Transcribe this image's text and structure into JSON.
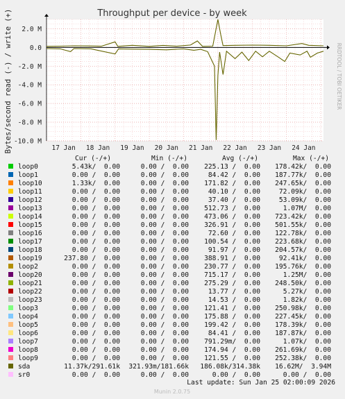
{
  "chart_data": {
    "type": "line",
    "title": "Throughput per device - by week",
    "ylabel": "Bytes/second read (-) / write (+)",
    "side_label": "RRDTOOL / TOBI OETIKER",
    "ylim": [
      -10000000,
      3000000
    ],
    "y_ticks": [
      {
        "value": 2000000,
        "label": "2.0 M"
      },
      {
        "value": 0,
        "label": "0.0"
      },
      {
        "value": -2000000,
        "label": "-2.0 M"
      },
      {
        "value": -4000000,
        "label": "-4.0 M"
      },
      {
        "value": -6000000,
        "label": "-6.0 M"
      },
      {
        "value": -8000000,
        "label": "-8.0 M"
      },
      {
        "value": -10000000,
        "label": "-10.0 M"
      }
    ],
    "x_ticks": [
      {
        "day": 0.5,
        "label": "17 Jan"
      },
      {
        "day": 1.5,
        "label": "18 Jan"
      },
      {
        "day": 2.5,
        "label": "19 Jan"
      },
      {
        "day": 3.5,
        "label": "20 Jan"
      },
      {
        "day": 4.5,
        "label": "21 Jan"
      },
      {
        "day": 5.5,
        "label": "22 Jan"
      },
      {
        "day": 6.5,
        "label": "23 Jan"
      },
      {
        "day": 7.5,
        "label": "24 Jan"
      }
    ],
    "x_range_days": [
      0,
      8.08
    ],
    "series": [
      {
        "name": "sda (write)",
        "color": "#666600",
        "points": [
          [
            0,
            120000
          ],
          [
            0.4,
            140000
          ],
          [
            0.8,
            180000
          ],
          [
            1.2,
            160000
          ],
          [
            1.6,
            130000
          ],
          [
            2.0,
            600000
          ],
          [
            2.08,
            120000
          ],
          [
            2.5,
            230000
          ],
          [
            3.0,
            120000
          ],
          [
            3.4,
            220000
          ],
          [
            3.8,
            130000
          ],
          [
            4.2,
            260000
          ],
          [
            4.4,
            700000
          ],
          [
            4.55,
            120000
          ],
          [
            4.85,
            140000
          ],
          [
            5.0,
            3000000
          ],
          [
            5.08,
            1400000
          ],
          [
            5.15,
            200000
          ],
          [
            5.5,
            230000
          ],
          [
            6.0,
            250000
          ],
          [
            6.5,
            230000
          ],
          [
            7.0,
            180000
          ],
          [
            7.45,
            420000
          ],
          [
            7.65,
            230000
          ],
          [
            8.08,
            180000
          ]
        ]
      },
      {
        "name": "sda (read)",
        "color": "#666600",
        "points": [
          [
            0,
            -120000
          ],
          [
            0.4,
            -150000
          ],
          [
            0.7,
            -450000
          ],
          [
            0.8,
            -120000
          ],
          [
            1.3,
            -150000
          ],
          [
            2.0,
            -700000
          ],
          [
            2.1,
            -150000
          ],
          [
            2.5,
            -180000
          ],
          [
            3.0,
            -200000
          ],
          [
            3.5,
            -250000
          ],
          [
            4.0,
            -150000
          ],
          [
            4.3,
            -300000
          ],
          [
            4.5,
            -200000
          ],
          [
            4.7,
            -450000
          ],
          [
            4.9,
            -2000000
          ],
          [
            4.95,
            -9900000
          ],
          [
            5.0,
            -3000000
          ],
          [
            5.05,
            -500000
          ],
          [
            5.15,
            -2900000
          ],
          [
            5.25,
            -400000
          ],
          [
            5.5,
            -1200000
          ],
          [
            5.7,
            -500000
          ],
          [
            5.9,
            -1400000
          ],
          [
            6.1,
            -400000
          ],
          [
            6.3,
            -1000000
          ],
          [
            6.5,
            -400000
          ],
          [
            6.75,
            -1000000
          ],
          [
            6.95,
            -1500000
          ],
          [
            7.1,
            -600000
          ],
          [
            7.4,
            -800000
          ],
          [
            7.6,
            -400000
          ],
          [
            7.7,
            -1050000
          ],
          [
            7.9,
            -600000
          ],
          [
            8.08,
            -400000
          ]
        ]
      }
    ],
    "legend": {
      "headers": [
        "Cur (-/+)",
        "Min (-/+)",
        "Avg (-/+)",
        "Max (-/+)"
      ],
      "rows": [
        {
          "name": "loop0",
          "color": "#00cc00",
          "cur": "5.43k/  0.00",
          "min": "0.00 /  0.00",
          "avg": "225.13 /  0.00",
          "max": "178.42k/  0.00"
        },
        {
          "name": "loop1",
          "color": "#0066b3",
          "cur": "0.00 /  0.00",
          "min": "0.00 /  0.00",
          "avg": "84.42 /  0.00",
          "max": "187.77k/  0.00"
        },
        {
          "name": "loop10",
          "color": "#ff8000",
          "cur": "1.33k/  0.00",
          "min": "0.00 /  0.00",
          "avg": "171.82 /  0.00",
          "max": "247.65k/  0.00"
        },
        {
          "name": "loop11",
          "color": "#ffcc00",
          "cur": "0.00 /  0.00",
          "min": "0.00 /  0.00",
          "avg": "40.10 /  0.00",
          "max": "72.09k/  0.00"
        },
        {
          "name": "loop12",
          "color": "#330099",
          "cur": "0.00 /  0.00",
          "min": "0.00 /  0.00",
          "avg": "37.40 /  0.00",
          "max": "53.09k/  0.00"
        },
        {
          "name": "loop13",
          "color": "#990099",
          "cur": "0.00 /  0.00",
          "min": "0.00 /  0.00",
          "avg": "512.73 /  0.00",
          "max": "1.07M/  0.00"
        },
        {
          "name": "loop14",
          "color": "#ccff00",
          "cur": "0.00 /  0.00",
          "min": "0.00 /  0.00",
          "avg": "473.06 /  0.00",
          "max": "723.42k/  0.00"
        },
        {
          "name": "loop15",
          "color": "#ff0000",
          "cur": "0.00 /  0.00",
          "min": "0.00 /  0.00",
          "avg": "326.91 /  0.00",
          "max": "501.55k/  0.00"
        },
        {
          "name": "loop16",
          "color": "#808080",
          "cur": "0.00 /  0.00",
          "min": "0.00 /  0.00",
          "avg": "72.60 /  0.00",
          "max": "122.78k/  0.00"
        },
        {
          "name": "loop17",
          "color": "#008f00",
          "cur": "0.00 /  0.00",
          "min": "0.00 /  0.00",
          "avg": "100.54 /  0.00",
          "max": "223.68k/  0.00"
        },
        {
          "name": "loop18",
          "color": "#00487d",
          "cur": "0.00 /  0.00",
          "min": "0.00 /  0.00",
          "avg": "91.97 /  0.00",
          "max": "204.57k/  0.00"
        },
        {
          "name": "loop19",
          "color": "#b35a00",
          "cur": "237.80 /  0.00",
          "min": "0.00 /  0.00",
          "avg": "388.91 /  0.00",
          "max": "92.41k/  0.00"
        },
        {
          "name": "loop2",
          "color": "#b38f00",
          "cur": "0.00 /  0.00",
          "min": "0.00 /  0.00",
          "avg": "230.77 /  0.00",
          "max": "195.76k/  0.00"
        },
        {
          "name": "loop20",
          "color": "#6b006b",
          "cur": "0.00 /  0.00",
          "min": "0.00 /  0.00",
          "avg": "715.17 /  0.00",
          "max": "1.25M/  0.00"
        },
        {
          "name": "loop21",
          "color": "#8fb300",
          "cur": "0.00 /  0.00",
          "min": "0.00 /  0.00",
          "avg": "275.29 /  0.00",
          "max": "248.50k/  0.00"
        },
        {
          "name": "loop22",
          "color": "#b30000",
          "cur": "0.00 /  0.00",
          "min": "0.00 /  0.00",
          "avg": "13.77 /  0.00",
          "max": "5.27k/  0.00"
        },
        {
          "name": "loop23",
          "color": "#bebebe",
          "cur": "0.00 /  0.00",
          "min": "0.00 /  0.00",
          "avg": "14.53 /  0.00",
          "max": "1.82k/  0.00"
        },
        {
          "name": "loop3",
          "color": "#80ff80",
          "cur": "0.00 /  0.00",
          "min": "0.00 /  0.00",
          "avg": "121.41 /  0.00",
          "max": "250.98k/  0.00"
        },
        {
          "name": "loop4",
          "color": "#80c9ff",
          "cur": "0.00 /  0.00",
          "min": "0.00 /  0.00",
          "avg": "175.88 /  0.00",
          "max": "227.45k/  0.00"
        },
        {
          "name": "loop5",
          "color": "#ffc080",
          "cur": "0.00 /  0.00",
          "min": "0.00 /  0.00",
          "avg": "199.42 /  0.00",
          "max": "178.39k/  0.00"
        },
        {
          "name": "loop6",
          "color": "#ffe680",
          "cur": "0.00 /  0.00",
          "min": "0.00 /  0.00",
          "avg": "84.41 /  0.00",
          "max": "187.87k/  0.00"
        },
        {
          "name": "loop7",
          "color": "#aa80ff",
          "cur": "0.00 /  0.00",
          "min": "0.00 /  0.00",
          "avg": "791.29m/  0.00",
          "max": "1.07k/  0.00"
        },
        {
          "name": "loop8",
          "color": "#ee00cc",
          "cur": "0.00 /  0.00",
          "min": "0.00 /  0.00",
          "avg": "174.94 /  0.00",
          "max": "261.69k/  0.00"
        },
        {
          "name": "loop9",
          "color": "#ff8080",
          "cur": "0.00 /  0.00",
          "min": "0.00 /  0.00",
          "avg": "121.55 /  0.00",
          "max": "252.38k/  0.00"
        },
        {
          "name": "sda",
          "color": "#666600",
          "cur": "11.37k/291.61k",
          "min": "321.93m/181.66k",
          "avg": "186.08k/314.38k",
          "max": "16.62M/  3.94M"
        },
        {
          "name": "sr0",
          "color": "#ffbfff",
          "cur": "0.00 /  0.00",
          "min": "0.00 /  0.00",
          "avg": "0.00 /  0.00",
          "max": "0.00 /  0.00"
        }
      ]
    }
  },
  "footer": {
    "last_update": "Last update: Sun Jan 25 02:00:09 2026",
    "version": "Munin 2.0.75"
  }
}
